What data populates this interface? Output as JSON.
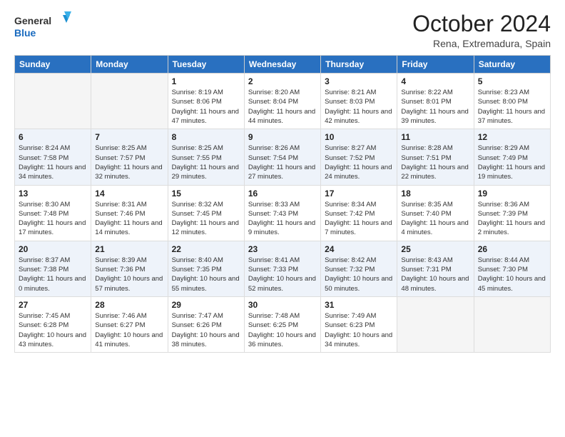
{
  "header": {
    "logo_general": "General",
    "logo_blue": "Blue",
    "month": "October 2024",
    "location": "Rena, Extremadura, Spain"
  },
  "weekdays": [
    "Sunday",
    "Monday",
    "Tuesday",
    "Wednesday",
    "Thursday",
    "Friday",
    "Saturday"
  ],
  "weeks": [
    [
      {
        "day": "",
        "sunrise": "",
        "sunset": "",
        "daylight": ""
      },
      {
        "day": "",
        "sunrise": "",
        "sunset": "",
        "daylight": ""
      },
      {
        "day": "1",
        "sunrise": "Sunrise: 8:19 AM",
        "sunset": "Sunset: 8:06 PM",
        "daylight": "Daylight: 11 hours and 47 minutes."
      },
      {
        "day": "2",
        "sunrise": "Sunrise: 8:20 AM",
        "sunset": "Sunset: 8:04 PM",
        "daylight": "Daylight: 11 hours and 44 minutes."
      },
      {
        "day": "3",
        "sunrise": "Sunrise: 8:21 AM",
        "sunset": "Sunset: 8:03 PM",
        "daylight": "Daylight: 11 hours and 42 minutes."
      },
      {
        "day": "4",
        "sunrise": "Sunrise: 8:22 AM",
        "sunset": "Sunset: 8:01 PM",
        "daylight": "Daylight: 11 hours and 39 minutes."
      },
      {
        "day": "5",
        "sunrise": "Sunrise: 8:23 AM",
        "sunset": "Sunset: 8:00 PM",
        "daylight": "Daylight: 11 hours and 37 minutes."
      }
    ],
    [
      {
        "day": "6",
        "sunrise": "Sunrise: 8:24 AM",
        "sunset": "Sunset: 7:58 PM",
        "daylight": "Daylight: 11 hours and 34 minutes."
      },
      {
        "day": "7",
        "sunrise": "Sunrise: 8:25 AM",
        "sunset": "Sunset: 7:57 PM",
        "daylight": "Daylight: 11 hours and 32 minutes."
      },
      {
        "day": "8",
        "sunrise": "Sunrise: 8:25 AM",
        "sunset": "Sunset: 7:55 PM",
        "daylight": "Daylight: 11 hours and 29 minutes."
      },
      {
        "day": "9",
        "sunrise": "Sunrise: 8:26 AM",
        "sunset": "Sunset: 7:54 PM",
        "daylight": "Daylight: 11 hours and 27 minutes."
      },
      {
        "day": "10",
        "sunrise": "Sunrise: 8:27 AM",
        "sunset": "Sunset: 7:52 PM",
        "daylight": "Daylight: 11 hours and 24 minutes."
      },
      {
        "day": "11",
        "sunrise": "Sunrise: 8:28 AM",
        "sunset": "Sunset: 7:51 PM",
        "daylight": "Daylight: 11 hours and 22 minutes."
      },
      {
        "day": "12",
        "sunrise": "Sunrise: 8:29 AM",
        "sunset": "Sunset: 7:49 PM",
        "daylight": "Daylight: 11 hours and 19 minutes."
      }
    ],
    [
      {
        "day": "13",
        "sunrise": "Sunrise: 8:30 AM",
        "sunset": "Sunset: 7:48 PM",
        "daylight": "Daylight: 11 hours and 17 minutes."
      },
      {
        "day": "14",
        "sunrise": "Sunrise: 8:31 AM",
        "sunset": "Sunset: 7:46 PM",
        "daylight": "Daylight: 11 hours and 14 minutes."
      },
      {
        "day": "15",
        "sunrise": "Sunrise: 8:32 AM",
        "sunset": "Sunset: 7:45 PM",
        "daylight": "Daylight: 11 hours and 12 minutes."
      },
      {
        "day": "16",
        "sunrise": "Sunrise: 8:33 AM",
        "sunset": "Sunset: 7:43 PM",
        "daylight": "Daylight: 11 hours and 9 minutes."
      },
      {
        "day": "17",
        "sunrise": "Sunrise: 8:34 AM",
        "sunset": "Sunset: 7:42 PM",
        "daylight": "Daylight: 11 hours and 7 minutes."
      },
      {
        "day": "18",
        "sunrise": "Sunrise: 8:35 AM",
        "sunset": "Sunset: 7:40 PM",
        "daylight": "Daylight: 11 hours and 4 minutes."
      },
      {
        "day": "19",
        "sunrise": "Sunrise: 8:36 AM",
        "sunset": "Sunset: 7:39 PM",
        "daylight": "Daylight: 11 hours and 2 minutes."
      }
    ],
    [
      {
        "day": "20",
        "sunrise": "Sunrise: 8:37 AM",
        "sunset": "Sunset: 7:38 PM",
        "daylight": "Daylight: 11 hours and 0 minutes."
      },
      {
        "day": "21",
        "sunrise": "Sunrise: 8:39 AM",
        "sunset": "Sunset: 7:36 PM",
        "daylight": "Daylight: 10 hours and 57 minutes."
      },
      {
        "day": "22",
        "sunrise": "Sunrise: 8:40 AM",
        "sunset": "Sunset: 7:35 PM",
        "daylight": "Daylight: 10 hours and 55 minutes."
      },
      {
        "day": "23",
        "sunrise": "Sunrise: 8:41 AM",
        "sunset": "Sunset: 7:33 PM",
        "daylight": "Daylight: 10 hours and 52 minutes."
      },
      {
        "day": "24",
        "sunrise": "Sunrise: 8:42 AM",
        "sunset": "Sunset: 7:32 PM",
        "daylight": "Daylight: 10 hours and 50 minutes."
      },
      {
        "day": "25",
        "sunrise": "Sunrise: 8:43 AM",
        "sunset": "Sunset: 7:31 PM",
        "daylight": "Daylight: 10 hours and 48 minutes."
      },
      {
        "day": "26",
        "sunrise": "Sunrise: 8:44 AM",
        "sunset": "Sunset: 7:30 PM",
        "daylight": "Daylight: 10 hours and 45 minutes."
      }
    ],
    [
      {
        "day": "27",
        "sunrise": "Sunrise: 7:45 AM",
        "sunset": "Sunset: 6:28 PM",
        "daylight": "Daylight: 10 hours and 43 minutes."
      },
      {
        "day": "28",
        "sunrise": "Sunrise: 7:46 AM",
        "sunset": "Sunset: 6:27 PM",
        "daylight": "Daylight: 10 hours and 41 minutes."
      },
      {
        "day": "29",
        "sunrise": "Sunrise: 7:47 AM",
        "sunset": "Sunset: 6:26 PM",
        "daylight": "Daylight: 10 hours and 38 minutes."
      },
      {
        "day": "30",
        "sunrise": "Sunrise: 7:48 AM",
        "sunset": "Sunset: 6:25 PM",
        "daylight": "Daylight: 10 hours and 36 minutes."
      },
      {
        "day": "31",
        "sunrise": "Sunrise: 7:49 AM",
        "sunset": "Sunset: 6:23 PM",
        "daylight": "Daylight: 10 hours and 34 minutes."
      },
      {
        "day": "",
        "sunrise": "",
        "sunset": "",
        "daylight": ""
      },
      {
        "day": "",
        "sunrise": "",
        "sunset": "",
        "daylight": ""
      }
    ]
  ]
}
